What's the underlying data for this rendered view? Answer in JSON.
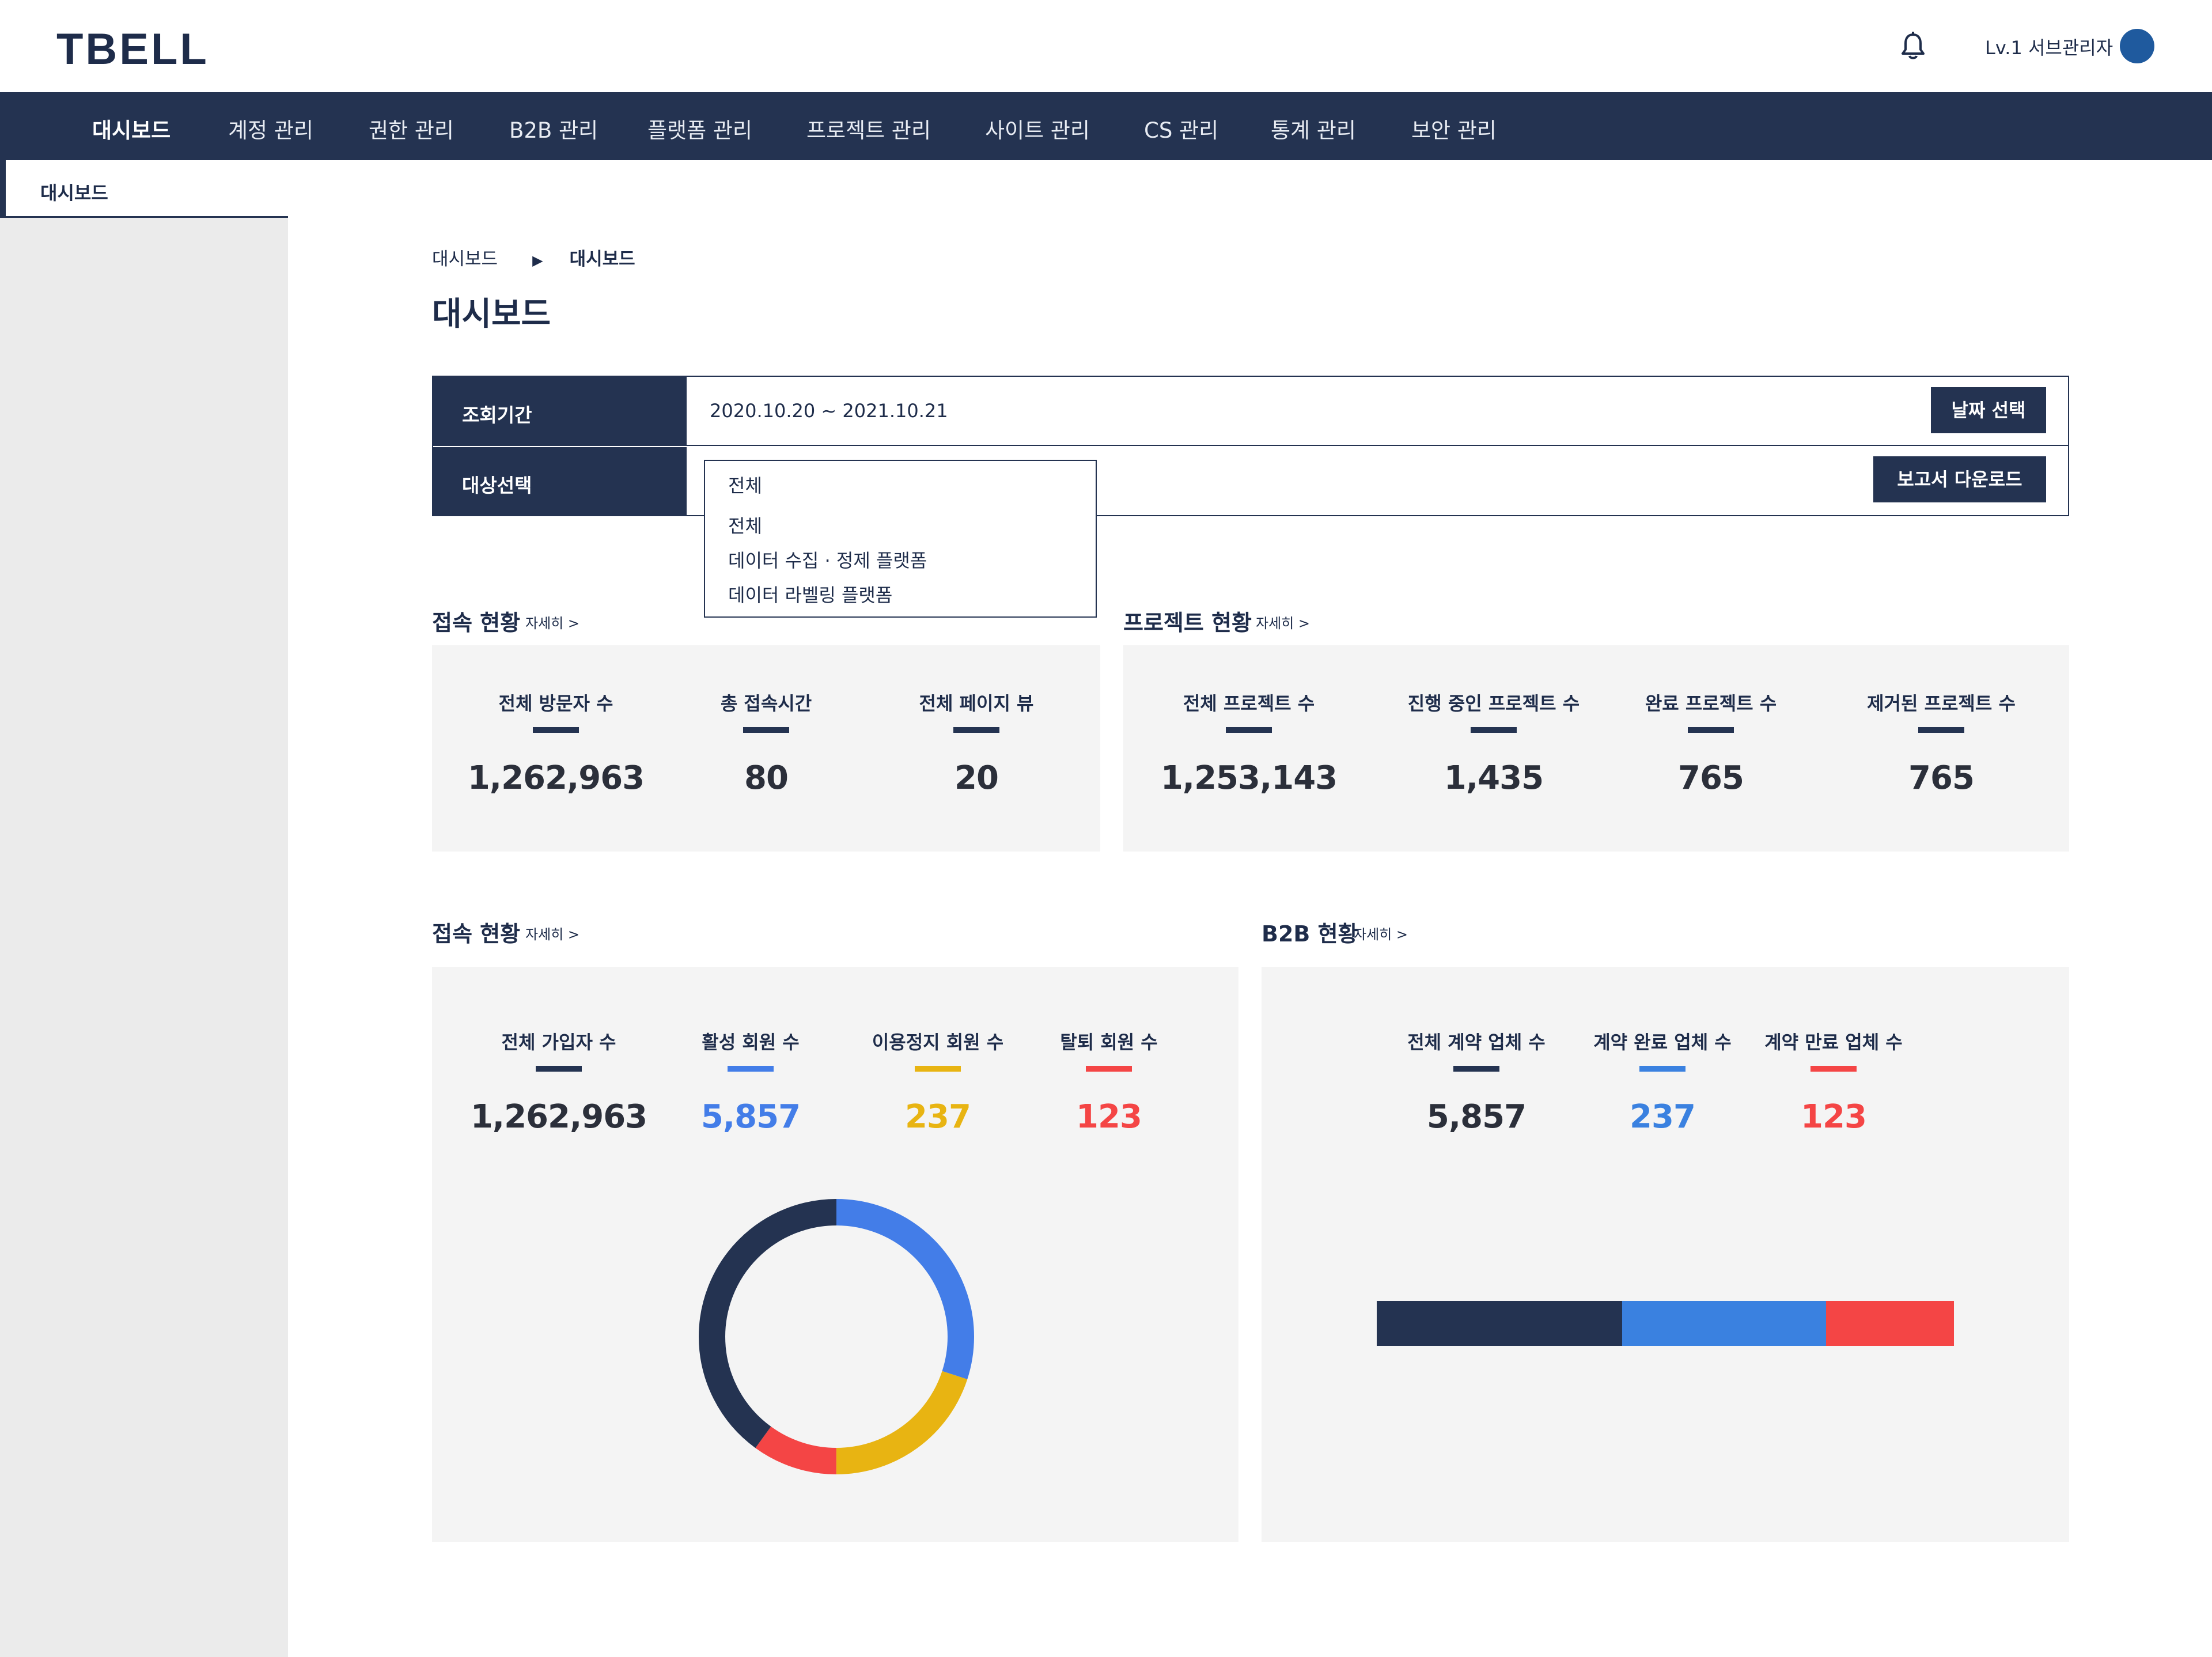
{
  "header": {
    "logo": "TBELL",
    "user_label": "Lv.1 서브관리자"
  },
  "nav": {
    "items": [
      "대시보드",
      "계정 관리",
      "권한 관리",
      "B2B 관리",
      "플랫폼 관리",
      "프로젝트 관리",
      "사이트 관리",
      "CS 관리",
      "통계 관리",
      "보안 관리"
    ],
    "active_index": 0
  },
  "sidebar": {
    "items": [
      "대시보드"
    ]
  },
  "breadcrumb": {
    "parent": "대시보드",
    "separator": "▶",
    "current": "대시보드"
  },
  "page_title": "대시보드",
  "filter": {
    "period_label": "조회기간",
    "period_value": "2020.10.20 ~ 2021.10.21",
    "date_button": "날짜 선택",
    "target_label": "대상선택",
    "report_button": "보고서 다운로드",
    "dropdown_selected": "전체",
    "dropdown_options": [
      "전체",
      "데이터 수집 · 정제 플랫폼",
      "데이터 라벨링 플랫폼"
    ]
  },
  "access_section": {
    "title": "접속 현황",
    "more": "자세히 >",
    "stats": [
      {
        "label": "전체 방문자 수",
        "value": "1,262,963"
      },
      {
        "label": "총 접속시간",
        "value": "80"
      },
      {
        "label": "전체 페이지 뷰",
        "value": "20"
      }
    ]
  },
  "project_section": {
    "title": "프로젝트 현황",
    "more": "자세히 >",
    "stats": [
      {
        "label": "전체 프로젝트 수",
        "value": "1,253,143"
      },
      {
        "label": "진행 중인 프로젝트 수",
        "value": "1,435"
      },
      {
        "label": "완료 프로젝트 수",
        "value": "765"
      },
      {
        "label": "제거된 프로젝트 수",
        "value": "765"
      }
    ]
  },
  "member_section": {
    "title": "접속 현황",
    "more": "자세히 >",
    "stats": [
      {
        "label": "전체 가입자 수",
        "value": "1,262,963",
        "color": "#243351"
      },
      {
        "label": "활성 회원 수",
        "value": "5,857",
        "color": "#437de8"
      },
      {
        "label": "이용정지 회원 수",
        "value": "237",
        "color": "#e8b412"
      },
      {
        "label": "탈퇴 회원 수",
        "value": "123",
        "color": "#f44545"
      }
    ]
  },
  "b2b_section": {
    "title": "B2B 현황",
    "more": "자세히 >",
    "stats": [
      {
        "label": "전체 계약 업체 수",
        "value": "5,857",
        "color": "#243351"
      },
      {
        "label": "계약 완료 업체 수",
        "value": "237",
        "color": "#3a81e0"
      },
      {
        "label": "계약 만료 업체 수",
        "value": "123",
        "color": "#f44545"
      }
    ]
  },
  "colors": {
    "navy": "#243351",
    "blue": "#437de8",
    "yellow": "#e8b412",
    "red": "#f44545",
    "avatar": "#1f5a9e"
  },
  "chart_data": [
    {
      "type": "pie",
      "variant": "donut",
      "slices": [
        {
          "name": "활성 회원 수",
          "fraction": 0.3,
          "color": "#437de8"
        },
        {
          "name": "이용정지 회원 수",
          "fraction": 0.2,
          "color": "#e8b412"
        },
        {
          "name": "탈퇴 회원 수",
          "fraction": 0.1,
          "color": "#f44545"
        },
        {
          "name": "전체 가입자 수",
          "fraction": 0.4,
          "color": "#243351"
        }
      ]
    },
    {
      "type": "bar",
      "variant": "stacked-horizontal",
      "segments": [
        {
          "name": "전체 계약 업체 수",
          "fraction": 0.425,
          "color": "#243351"
        },
        {
          "name": "계약 완료 업체 수",
          "fraction": 0.353,
          "color": "#3a81e0"
        },
        {
          "name": "계약 만료 업체 수",
          "fraction": 0.222,
          "color": "#f44545"
        }
      ]
    }
  ]
}
